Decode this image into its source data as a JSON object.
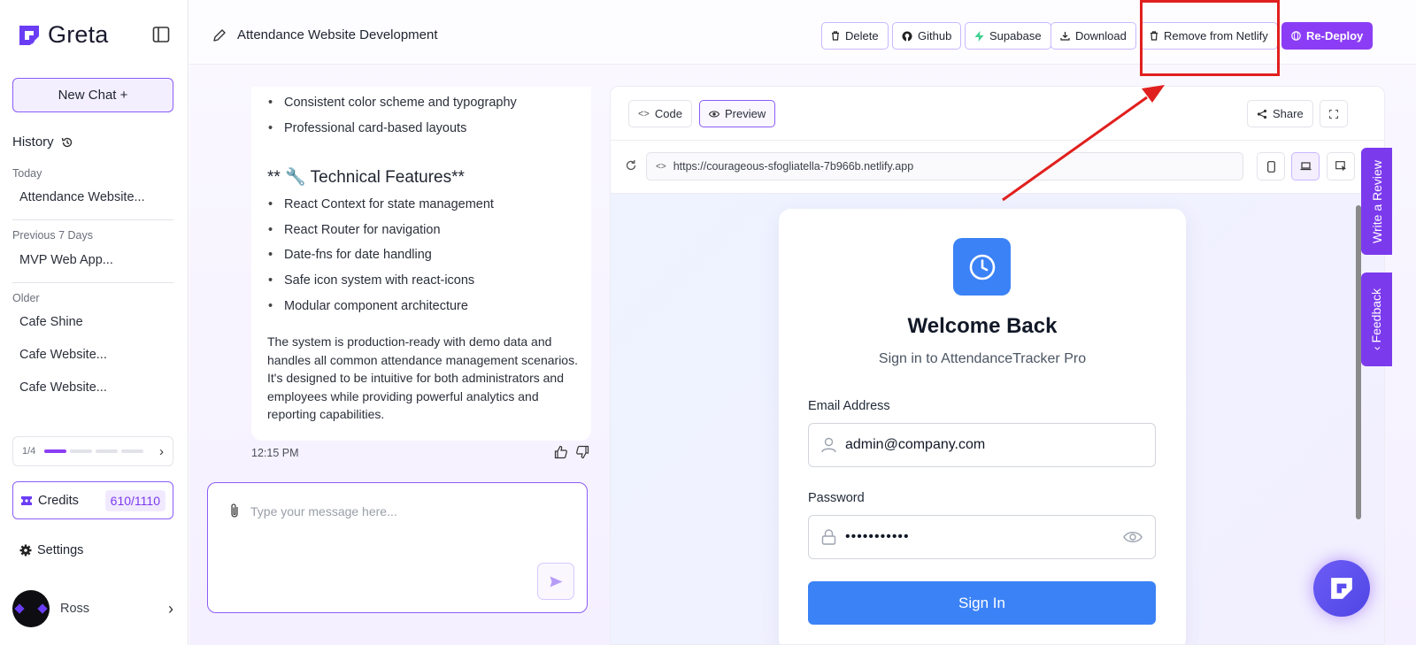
{
  "app": {
    "name": "Greta",
    "accent": "#8b3df5"
  },
  "sidebar": {
    "new_chat": "New Chat +",
    "history_label": "History",
    "groups": [
      {
        "label": "Today",
        "items": [
          "Attendance Website..."
        ]
      },
      {
        "label": "Previous 7 Days",
        "items": [
          "MVP Web App..."
        ]
      },
      {
        "label": "Older",
        "items": [
          "Cafe Shine",
          "Cafe Website...",
          "Cafe Website..."
        ]
      }
    ],
    "pager": {
      "text": "1/4",
      "current": 1,
      "total": 4
    },
    "credits_label": "Credits",
    "credits_value": "610/1110",
    "settings": "Settings",
    "user_name": "Ross"
  },
  "topbar": {
    "title": "Attendance Website Development",
    "buttons": {
      "delete": "Delete",
      "github": "Github",
      "supabase": "Supabase",
      "download": "Download",
      "remove_netlify": "Remove from Netlify",
      "redeploy": "Re-Deploy"
    }
  },
  "chat": {
    "bullets_top": [
      "Consistent color scheme and typography",
      "Professional card-based layouts"
    ],
    "tech_heading": "** 🔧 Technical Features**",
    "tech_bullets": [
      "React Context for state management",
      "React Router for navigation",
      "Date-fns for date handling",
      "Safe icon system with react-icons",
      "Modular component architecture"
    ],
    "paragraph": "The system is production-ready with demo data and handles all common attendance management scenarios. It's designed to be intuitive for both administrators and employees while providing powerful analytics and reporting capabilities.",
    "timestamp": "12:15 PM",
    "input_placeholder": "Type your message here..."
  },
  "preview": {
    "tab_code": "Code",
    "tab_preview": "Preview",
    "share": "Share",
    "url": "https://courageous-sfogliatella-7b966b.netlify.app",
    "login": {
      "title": "Welcome Back",
      "subtitle": "Sign in to AttendanceTracker Pro",
      "email_label": "Email Address",
      "email_value": "admin@company.com",
      "password_label": "Password",
      "password_value": "•••••••••••",
      "signin": "Sign In"
    }
  },
  "side_tabs": {
    "review": "Write a Review",
    "feedback": "Feedback"
  }
}
